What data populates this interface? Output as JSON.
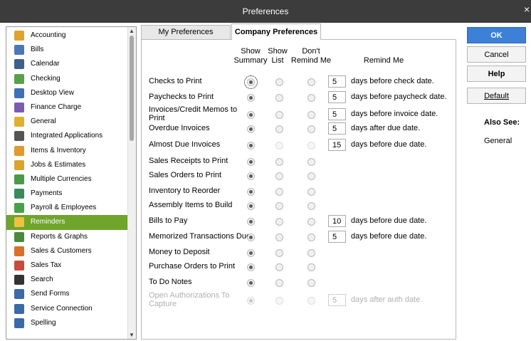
{
  "window": {
    "title": "Preferences",
    "close_glyph": "×"
  },
  "sidebar": {
    "items": [
      {
        "label": "Accounting",
        "icon": "accounting-icon",
        "color": "#e0a32e"
      },
      {
        "label": "Bills",
        "icon": "bills-icon",
        "color": "#4a78b8"
      },
      {
        "label": "Calendar",
        "icon": "calendar-icon",
        "color": "#3e5f8a"
      },
      {
        "label": "Checking",
        "icon": "checking-icon",
        "color": "#5aa04a"
      },
      {
        "label": "Desktop View",
        "icon": "desktop-view-icon",
        "color": "#3f6fb5"
      },
      {
        "label": "Finance Charge",
        "icon": "finance-charge-icon",
        "color": "#7a5cb0"
      },
      {
        "label": "General",
        "icon": "general-icon",
        "color": "#e0b030"
      },
      {
        "label": "Integrated Applications",
        "icon": "integrated-apps-icon",
        "color": "#555555"
      },
      {
        "label": "Items & Inventory",
        "icon": "items-inventory-icon",
        "color": "#e09a2e"
      },
      {
        "label": "Jobs & Estimates",
        "icon": "jobs-estimates-icon",
        "color": "#d9a52c"
      },
      {
        "label": "Multiple Currencies",
        "icon": "multiple-currencies-icon",
        "color": "#4a9a4a"
      },
      {
        "label": "Payments",
        "icon": "payments-icon",
        "color": "#3a8a5a"
      },
      {
        "label": "Payroll & Employees",
        "icon": "payroll-icon",
        "color": "#4aa04a"
      },
      {
        "label": "Reminders",
        "icon": "reminders-icon",
        "color": "#f0c040"
      },
      {
        "label": "Reports & Graphs",
        "icon": "reports-graphs-icon",
        "color": "#4a8a3a"
      },
      {
        "label": "Sales & Customers",
        "icon": "sales-customers-icon",
        "color": "#d9702c"
      },
      {
        "label": "Sales Tax",
        "icon": "sales-tax-icon",
        "color": "#c84a3a"
      },
      {
        "label": "Search",
        "icon": "search-icon",
        "color": "#333333"
      },
      {
        "label": "Send Forms",
        "icon": "send-forms-icon",
        "color": "#3a6aa8"
      },
      {
        "label": "Service Connection",
        "icon": "service-connection-icon",
        "color": "#3a6aa8"
      },
      {
        "label": "Spelling",
        "icon": "spelling-icon",
        "color": "#3a6aa8"
      }
    ],
    "selected": "Reminders"
  },
  "tabs": [
    {
      "label": "My Preferences",
      "active": false
    },
    {
      "label": "Company Preferences",
      "active": true
    }
  ],
  "columns": {
    "show_summary_1": "Show",
    "show_summary_2": "Summary",
    "show_list_1": "Show",
    "show_list_2": "List",
    "dont_remind_1": "Don't",
    "dont_remind_2": "Remind Me",
    "remind_me": "Remind Me"
  },
  "rows": [
    {
      "label": "Checks to Print",
      "selected": "summary",
      "days": "5",
      "text": "days before check date."
    },
    {
      "label": "Paychecks to Print",
      "selected": "summary",
      "days": "5",
      "text": "days before paycheck date."
    },
    {
      "label": "Invoices/Credit Memos to Print",
      "selected": "summary",
      "days": "5",
      "text": "days before invoice date."
    },
    {
      "label": "Overdue Invoices",
      "selected": "summary",
      "days": "5",
      "text": "days after due date."
    },
    {
      "label": "Almost Due Invoices",
      "selected": "summary",
      "days": "15",
      "text": "days before due date."
    },
    {
      "label": "Sales Receipts to Print",
      "selected": "summary"
    },
    {
      "label": "Sales Orders to Print",
      "selected": "summary"
    },
    {
      "label": "Inventory to Reorder",
      "selected": "summary"
    },
    {
      "label": "Assembly Items to Build",
      "selected": "summary"
    },
    {
      "label": "Bills to Pay",
      "selected": "summary",
      "days": "10",
      "text": "days before due date."
    },
    {
      "label": "Memorized Transactions Due",
      "selected": "summary",
      "days": "5",
      "text": "days before due date."
    },
    {
      "label": "Money to Deposit",
      "selected": "summary"
    },
    {
      "label": "Purchase Orders to Print",
      "selected": "summary"
    },
    {
      "label": "To Do Notes",
      "selected": "summary"
    },
    {
      "label": "Open Authorizations To Capture",
      "selected": "summary",
      "days": "5",
      "text": "days after auth date.",
      "disabled": true
    }
  ],
  "buttons": {
    "ok": "OK",
    "cancel": "Cancel",
    "help": "Help",
    "default": "Default"
  },
  "also_see": {
    "heading": "Also See:",
    "link": "General"
  },
  "colors": {
    "title_bar": "#3c3c3c",
    "selected_item": "#6fa52a",
    "ok_button": "#3c80d8"
  }
}
